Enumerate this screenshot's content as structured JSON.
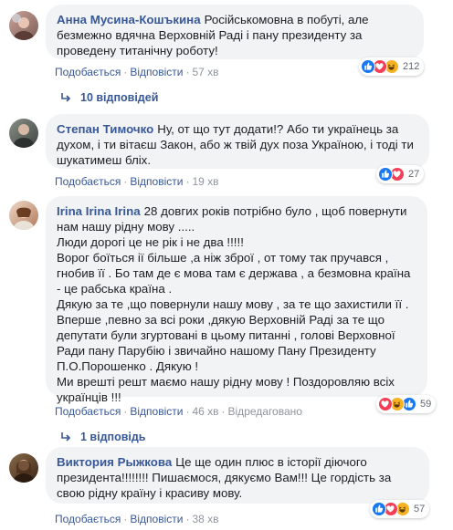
{
  "comments": [
    {
      "author": "Анна Мусина-Кошъкина",
      "text": "Російськомовна в побуті, але безмежно вдячна Верховній Раді і пану президенту за проведену титанічну роботу!",
      "like": "Подобається",
      "reply": "Відповісти",
      "time": "57 хв",
      "reaction_count": "212",
      "reactions": [
        "like",
        "love",
        "haha"
      ],
      "replies_label": "10 відповідей"
    },
    {
      "author": "Степан Тимочко",
      "text": "Ну, от що тут додати!? Або ти українець за духом, і ти вітаєш Закон, або ж твій дух поза Україною, і тоді ти шукатимеш бліх.",
      "like": "Подобається",
      "reply": "Відповісти",
      "time": "19 хв",
      "reaction_count": "27",
      "reactions": [
        "like",
        "love"
      ]
    },
    {
      "author": "Irina Irina Irina",
      "text": "28 довгих років потрібно було , щоб повернути нам нашу рідну мову .....\nЛюди дорогі це не рік і не два !!!!!\nВорог боїться ії більше ,а ніж зброї , от тому так пручався , гнобив її . Бо там де є мова там є держава , а безмовна країна - це рабська країна .\nДякую за те ,що повернули нашу мову , за те що захистили її .\nВперше ,певно за всі роки ,дякую Верховній Раді за те що депутати були згуртовані в цьому питанні , голові Верховної Ради пану Парубію і звичайно нашому Пану Президенту П.О.Порошенко . Дякую !\nМи врешті решт маємо нашу рідну мову ! Поздоровляю всіх українців !!!",
      "like": "Подобається",
      "reply": "Відповісти",
      "time": "46 хв",
      "edited": "Відредаговано",
      "reaction_count": "59",
      "reactions": [
        "love",
        "haha",
        "like"
      ],
      "replies_label": "1 відповідь"
    },
    {
      "author": "Виктория Рыжкова",
      "text": "Це ще один плюс в історії діючого президента!!!!!!!! Пишаємося, дякуємо Вам!!! Це гордість за свою рідну країну і красиву мову.",
      "like": "Подобається",
      "reply": "Відповісти",
      "time": "38 хв",
      "reaction_count": "57",
      "reactions": [
        "like",
        "love",
        "haha"
      ]
    }
  ],
  "colors": {
    "link": "#385898",
    "meta": "#90949c",
    "bubble": "#f2f3f5",
    "like": "#1877f2",
    "love": "#f33e58",
    "haha": "#f7b125"
  }
}
